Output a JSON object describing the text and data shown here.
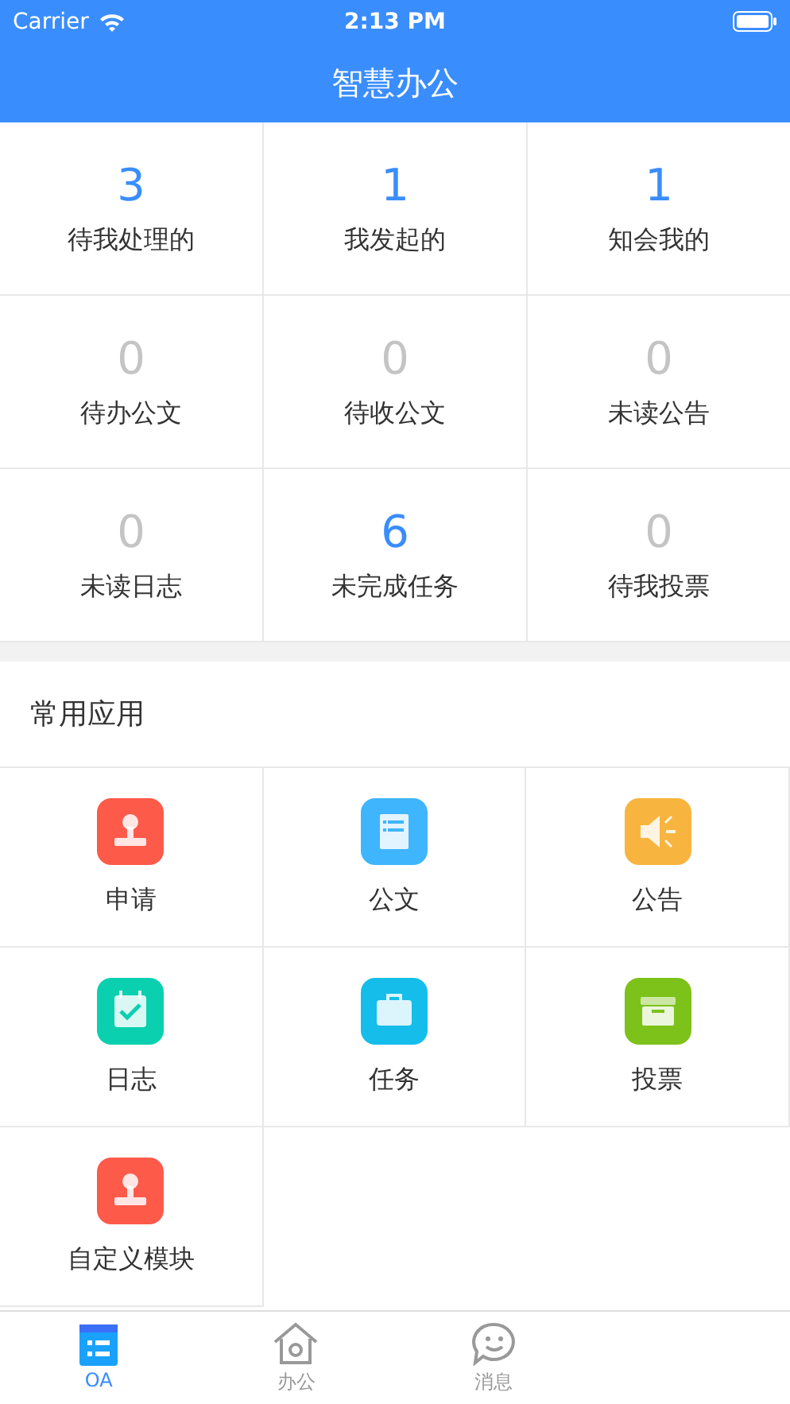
{
  "status_bar": {
    "carrier": "Carrier",
    "time": "2:13 PM"
  },
  "nav": {
    "title": "智慧办公"
  },
  "stats": [
    {
      "value": "3",
      "label": "待我处理的",
      "highlighted": true
    },
    {
      "value": "1",
      "label": "我发起的",
      "highlighted": true
    },
    {
      "value": "1",
      "label": "知会我的",
      "highlighted": true
    },
    {
      "value": "0",
      "label": "待办公文",
      "highlighted": false
    },
    {
      "value": "0",
      "label": "待收公文",
      "highlighted": false
    },
    {
      "value": "0",
      "label": "未读公告",
      "highlighted": false
    },
    {
      "value": "0",
      "label": "未读日志",
      "highlighted": false
    },
    {
      "value": "6",
      "label": "未完成任务",
      "highlighted": true
    },
    {
      "value": "0",
      "label": "待我投票",
      "highlighted": false
    }
  ],
  "apps_section": {
    "title": "常用应用"
  },
  "apps": [
    {
      "label": "申请",
      "kind": "stamp",
      "color": "#fd5a4a"
    },
    {
      "label": "公文",
      "kind": "document",
      "color": "#3fb5fd"
    },
    {
      "label": "公告",
      "kind": "speaker",
      "color": "#f7b53f"
    },
    {
      "label": "日志",
      "kind": "calendar",
      "color": "#0ad0b0"
    },
    {
      "label": "任务",
      "kind": "briefcase",
      "color": "#14bdea"
    },
    {
      "label": "投票",
      "kind": "box",
      "color": "#7dc21a"
    },
    {
      "label": "自定义模块",
      "kind": "stamp",
      "color": "#fd5a4a"
    }
  ],
  "tab_bar": [
    {
      "label": "OA",
      "kind": "list",
      "selected": true
    },
    {
      "label": "办公",
      "kind": "home",
      "selected": false
    },
    {
      "label": "消息",
      "kind": "chat",
      "selected": false
    }
  ]
}
